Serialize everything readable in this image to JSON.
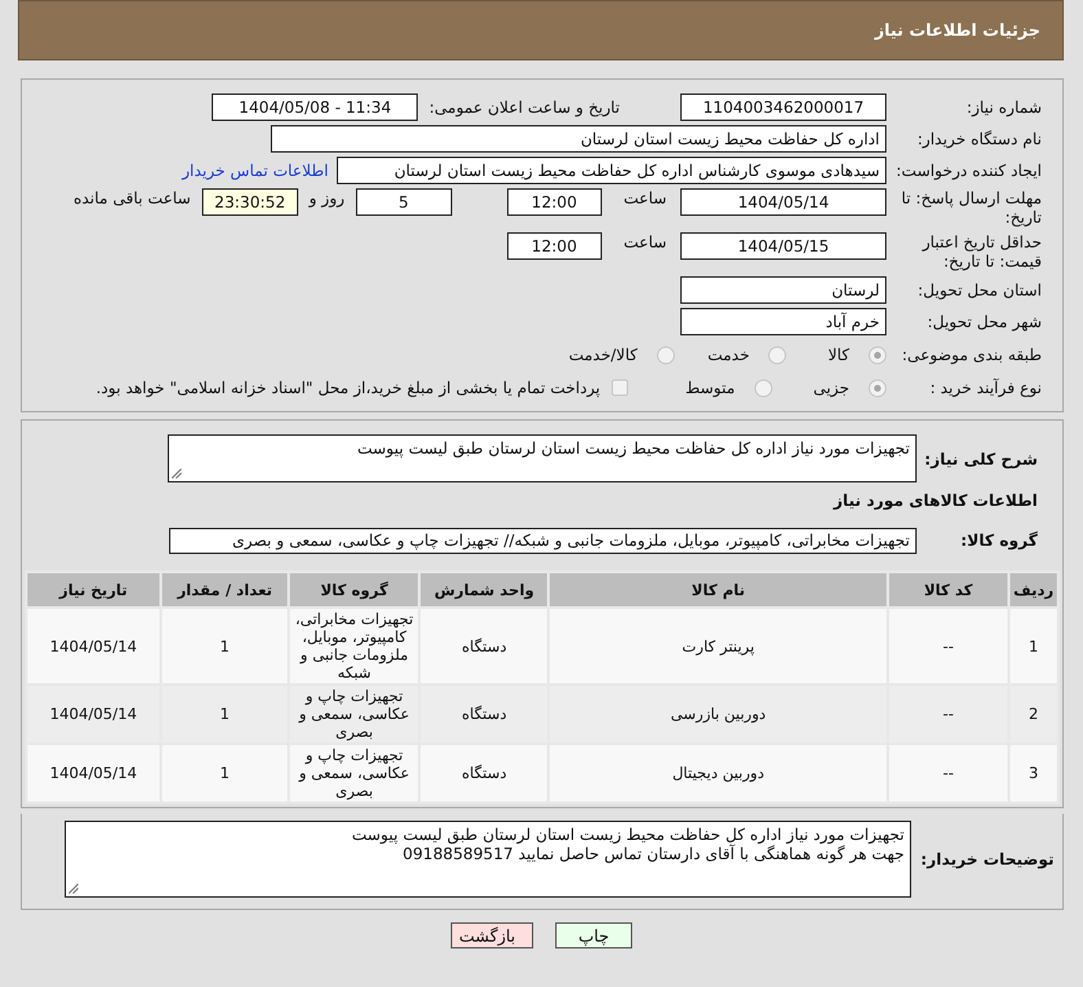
{
  "header": {
    "title": "جزئیات اطلاعات نیاز"
  },
  "details": {
    "need_number": {
      "label": "شماره نیاز:",
      "value": "1104003462000017"
    },
    "announce": {
      "label": "تاریخ و ساعت اعلان عمومی:",
      "value": "1404/05/08 - 11:34"
    },
    "buyer_org": {
      "label": "نام دستگاه خریدار:",
      "value": "اداره کل حفاظت محیط زیست استان لرستان"
    },
    "requester": {
      "label": "ایجاد کننده درخواست:",
      "value": "سیدهادی موسوی کارشناس اداره کل حفاظت محیط زیست استان لرستان",
      "link": "اطلاعات تماس خریدار"
    },
    "reply_deadline": {
      "label": "مهلت ارسال پاسخ: تا تاریخ:",
      "date": "1404/05/14",
      "time_label": "ساعت",
      "time": "12:00",
      "days": "5",
      "days_label": "روز و",
      "remaining": "23:30:52",
      "remaining_label": "ساعت باقی مانده"
    },
    "price_validity": {
      "label": "حداقل تاریخ اعتبار قیمت: تا تاریخ:",
      "date": "1404/05/15",
      "time_label": "ساعت",
      "time": "12:00"
    },
    "province": {
      "label": "استان محل تحویل:",
      "value": "لرستان"
    },
    "city": {
      "label": "شهر محل تحویل:",
      "value": "خرم آباد"
    },
    "category": {
      "label": "طبقه بندی موضوعی:",
      "options": [
        {
          "label": "کالا",
          "selected": true
        },
        {
          "label": "خدمت",
          "selected": false
        },
        {
          "label": "کالا/خدمت",
          "selected": false
        }
      ]
    },
    "process": {
      "label": "نوع فرآیند خرید :",
      "options": [
        {
          "label": "جزیی",
          "selected": true
        },
        {
          "label": "متوسط",
          "selected": false
        }
      ],
      "treasury": {
        "label": "پرداخت تمام یا بخشی از مبلغ خرید،از محل \"اسناد خزانه اسلامی\" خواهد بود.",
        "checked": false
      }
    }
  },
  "goods": {
    "description": {
      "label": "شرح کلی نیاز:",
      "value": "تجهیزات مورد نیاز اداره کل حفاظت محیط زیست استان لرستان طبق لیست پیوست"
    },
    "section_title": "اطلاعات کالاهای مورد نیاز",
    "group": {
      "label": "گروه کالا:",
      "value": "تجهیزات مخابراتی، کامپیوتر، موبایل، ملزومات جانبی و شبکه// تجهیزات چاپ و عکاسی، سمعی و بصری"
    },
    "table": {
      "columns": [
        "ردیف",
        "کد کالا",
        "نام کالا",
        "واحد شمارش",
        "گروه کالا",
        "تعداد / مقدار",
        "تاریخ نیاز"
      ],
      "rows": [
        [
          "1",
          "--",
          "پرینتر کارت",
          "دستگاه",
          "تجهیزات مخابراتی، کامپیوتر، موبایل، ملزومات جانبی و شبکه",
          "1",
          "1404/05/14"
        ],
        [
          "2",
          "--",
          "دوربین بازرسی",
          "دستگاه",
          "تجهیزات چاپ و عکاسی، سمعی و بصری",
          "1",
          "1404/05/14"
        ],
        [
          "3",
          "--",
          "دوربین دیجیتال",
          "دستگاه",
          "تجهیزات چاپ و عکاسی، سمعی و بصری",
          "1",
          "1404/05/14"
        ]
      ]
    }
  },
  "buyer_notes": {
    "label": "توضیحات خریدار:",
    "lines": [
      "تجهیزات مورد نیاز اداره کل حفاظت محیط زیست استان لرستان طبق لیست پیوست",
      "جهت هر گونه هماهنگی با آقای دارستان تماس حاصل نمایید 09188589517"
    ]
  },
  "buttons": [
    {
      "label": "چاپ",
      "kind": "print"
    },
    {
      "label": "بازگشت",
      "kind": "back"
    }
  ]
}
